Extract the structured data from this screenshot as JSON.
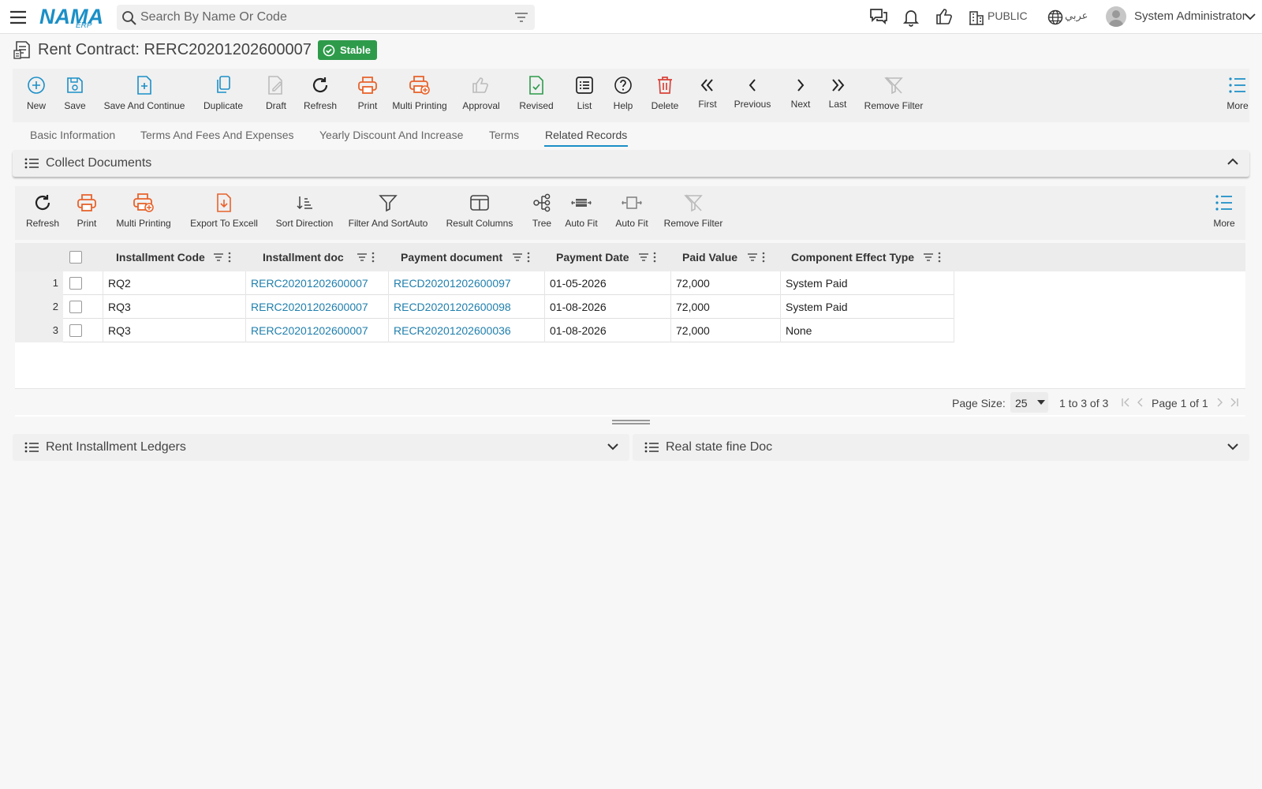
{
  "header": {
    "logo_main": "NAMA",
    "logo_sub": "ERP",
    "search_placeholder": "Search By Name Or Code",
    "branch": "PUBLIC",
    "language": "عربي",
    "user": "System Administrator"
  },
  "title": {
    "text": "Rent Contract: RERC20201202600007",
    "status": "Stable"
  },
  "toolbar": {
    "new": "New",
    "save": "Save",
    "save_continue": "Save And Continue",
    "duplicate": "Duplicate",
    "draft": "Draft",
    "refresh": "Refresh",
    "print": "Print",
    "multi_printing": "Multi Printing",
    "approval": "Approval",
    "revised": "Revised",
    "list": "List",
    "help": "Help",
    "delete": "Delete",
    "first": "First",
    "previous": "Previous",
    "next": "Next",
    "last": "Last",
    "remove_filter": "Remove Filter",
    "more": "More"
  },
  "tabs": [
    "Basic Information",
    "Terms And Fees And Expenses",
    "Yearly Discount And Increase",
    "Terms",
    "Related Records"
  ],
  "collect_panel": {
    "title": "Collect Documents",
    "toolbar": {
      "refresh": "Refresh",
      "print": "Print",
      "multi_printing": "Multi Printing",
      "export": "Export To Excell",
      "sort_direction": "Sort Direction",
      "filter_sort": "Filter And SortAuto",
      "result_columns": "Result Columns",
      "tree": "Tree",
      "auto_fit_1": "Auto Fit",
      "auto_fit_2": "Auto Fit",
      "remove_filter": "Remove Filter",
      "more": "More"
    },
    "columns": [
      "Installment Code",
      "Installment doc",
      "Payment document",
      "Payment Date",
      "Paid Value",
      "Component Effect Type"
    ],
    "rows": [
      [
        "1",
        "RQ2",
        "RERC20201202600007",
        "RECD20201202600097",
        "01-05-2026",
        "72,000",
        "System Paid"
      ],
      [
        "2",
        "RQ3",
        "RERC20201202600007",
        "RECD20201202600098",
        "01-08-2026",
        "72,000",
        "System Paid"
      ],
      [
        "3",
        "RQ3",
        "RERC20201202600007",
        "RECR20201202600036",
        "01-08-2026",
        "72,000",
        "None"
      ]
    ],
    "footer": {
      "page_size_label": "Page Size:",
      "page_size": "25",
      "range": "1 to 3 of 3",
      "page_info": "Page 1 of 1"
    }
  },
  "panels": {
    "ledgers": "Rent Installment Ledgers",
    "fine_doc": "Real state fine Doc"
  },
  "colors": {
    "accent": "#1b8fc7",
    "orange": "#e8632b",
    "green": "#2e9b4b",
    "red": "#d9433a",
    "disabled": "#bbbbbb"
  }
}
